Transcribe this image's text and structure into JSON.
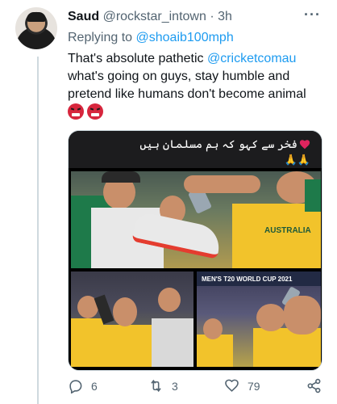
{
  "tweet": {
    "author_name": "Saud",
    "author_handle": "@rockstar_intown",
    "separator": "·",
    "time": "3h",
    "replying_prefix": "Replying to",
    "replying_handle": "@shoaib100mph",
    "text_part1": "That's absolute pathetic",
    "text_mention": "@cricketcomau",
    "text_part2": "what's going on guys, stay humble and pretend like humans don't become animal",
    "more_icon": "more-icon"
  },
  "media": {
    "caption_urdu": "فخر سے کہو کہ ہم مسلمان ہیں",
    "caption_emoji_after": "🙏🙏",
    "jersey_text_1": "AUSTRALIA",
    "banner_text": "MEN'S T20 WORLD CUP 2021",
    "accent_heart": "#e0245e"
  },
  "actions": {
    "reply_count": "6",
    "retweet_count": "3",
    "like_count": "79",
    "icons": [
      "reply-icon",
      "retweet-icon",
      "like-icon",
      "share-icon"
    ]
  },
  "colors": {
    "link": "#1d9bf0",
    "muted": "#536471",
    "text": "#0f1419"
  }
}
